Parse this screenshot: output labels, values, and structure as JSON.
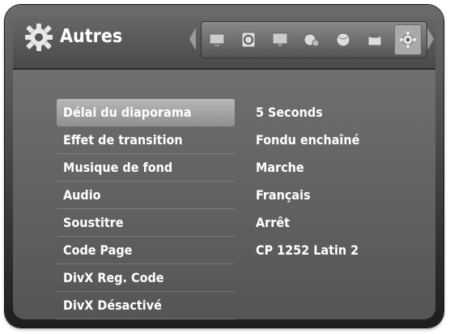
{
  "header": {
    "title": "Autres"
  },
  "tabs": [
    {
      "icon": "tv-icon",
      "active": false
    },
    {
      "icon": "disc-icon",
      "active": false
    },
    {
      "icon": "monitor-icon",
      "active": false
    },
    {
      "icon": "film-reel-icon",
      "active": false
    },
    {
      "icon": "globe-icon",
      "active": false
    },
    {
      "icon": "lock-icon",
      "active": false
    },
    {
      "icon": "gear-icon",
      "active": true
    }
  ],
  "menu": {
    "items": [
      {
        "label": "Délai du diaporama",
        "value": "5 Seconds"
      },
      {
        "label": "Effet de transition",
        "value": "Fondu enchaîné"
      },
      {
        "label": "Musique de fond",
        "value": "Marche"
      },
      {
        "label": "Audio",
        "value": "Français"
      },
      {
        "label": "Soustitre",
        "value": "Arrêt"
      },
      {
        "label": "Code Page",
        "value": "CP 1252 Latin 2"
      },
      {
        "label": "DivX Reg. Code",
        "value": ""
      },
      {
        "label": "DivX Désactivé",
        "value": ""
      }
    ],
    "selected_index": 0
  },
  "colors": {
    "selection_bg": "#a8a8a8",
    "text": "#ffffff",
    "panel": "#5a5a5a"
  }
}
